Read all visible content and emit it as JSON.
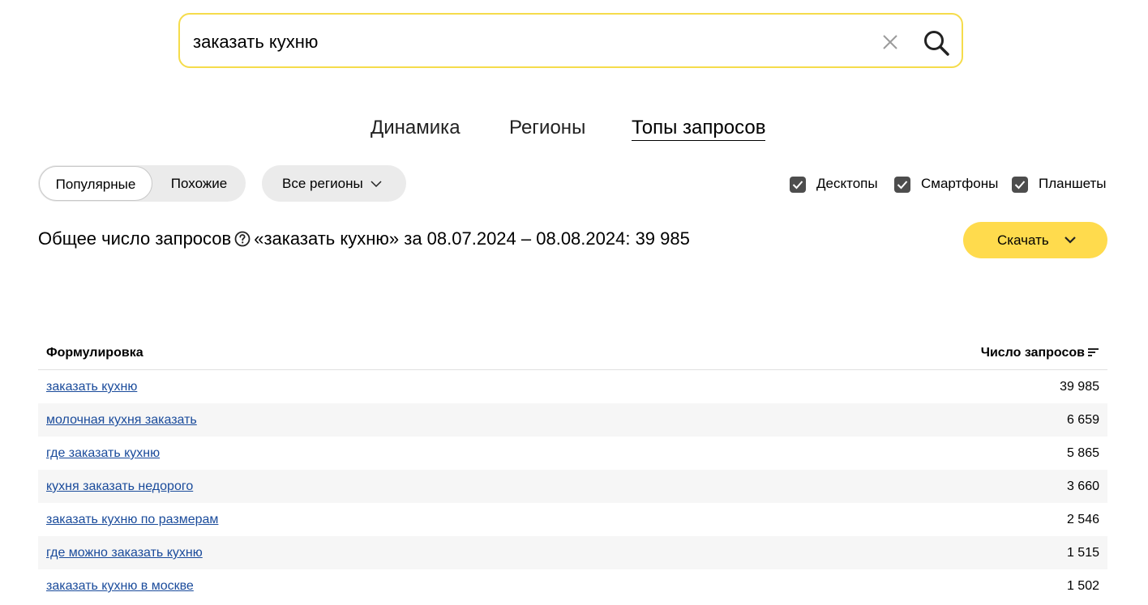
{
  "search": {
    "value": "заказать кухню",
    "clear_icon": "close-icon",
    "search_icon": "search-icon",
    "accent_color": "#f5dc4b"
  },
  "tabs": [
    {
      "label": "Динамика",
      "active": false
    },
    {
      "label": "Регионы",
      "active": false
    },
    {
      "label": "Топы запросов",
      "active": true
    }
  ],
  "filters": {
    "segments": [
      {
        "label": "Популярные",
        "active": true
      },
      {
        "label": "Похожие",
        "active": false
      }
    ],
    "region": {
      "label": "Все регионы",
      "icon": "chevron-down-icon"
    },
    "devices": [
      {
        "label": "Десктопы",
        "checked": true
      },
      {
        "label": "Смартфоны",
        "checked": true
      },
      {
        "label": "Планшеты",
        "checked": true
      }
    ]
  },
  "summary": {
    "prefix": "Общее число запросов",
    "help_icon": "question-circle-icon",
    "text": "«заказать кухню» за 08.07.2024 – 08.08.2024: 39 985"
  },
  "download": {
    "label": "Скачать",
    "color": "#ffdb4d",
    "icon": "chevron-down-icon"
  },
  "table": {
    "headers": {
      "phrase": "Формулировка",
      "count": "Число запросов"
    },
    "rows": [
      {
        "phrase": "заказать кухню",
        "count": "39 985"
      },
      {
        "phrase": "молочная кухня заказать",
        "count": "6 659"
      },
      {
        "phrase": "где заказать кухню",
        "count": "5 865"
      },
      {
        "phrase": "кухня заказать недорого",
        "count": "3 660"
      },
      {
        "phrase": "заказать кухню по размерам",
        "count": "2 546"
      },
      {
        "phrase": "где можно заказать кухню",
        "count": "1 515"
      },
      {
        "phrase": "заказать кухню в москве",
        "count": "1 502"
      }
    ],
    "link_color": "#1a4b9b"
  }
}
